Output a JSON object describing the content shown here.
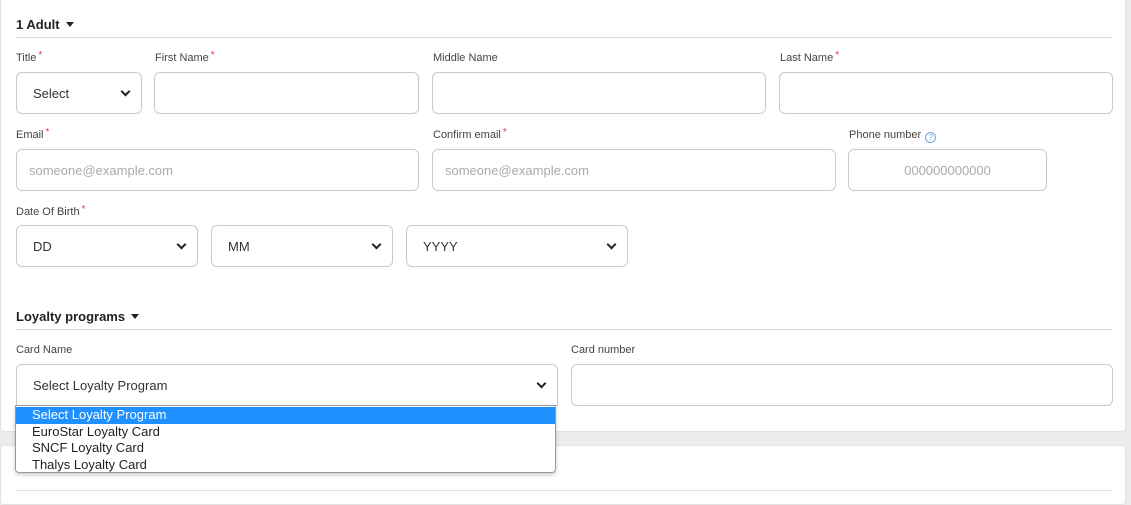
{
  "passenger": {
    "heading": "1 Adult",
    "title_label": "Title",
    "title_value": "Select",
    "first_name_label": "First Name",
    "middle_name_label": "Middle Name",
    "last_name_label": "Last Name",
    "email_label": "Email",
    "email_placeholder": "someone@example.com",
    "confirm_email_label": "Confirm email",
    "confirm_email_placeholder": "someone@example.com",
    "phone_label": "Phone number",
    "phone_help_icon": "question-circle-icon",
    "phone_placeholder": "000000000000",
    "dob_label": "Date Of Birth",
    "dob_day": "DD",
    "dob_month": "MM",
    "dob_year": "YYYY",
    "required_marker": "*"
  },
  "loyalty": {
    "heading": "Loyalty programs",
    "card_name_label": "Card Name",
    "card_name_value": "Select Loyalty Program",
    "card_number_label": "Card number",
    "options": [
      "Select Loyalty Program",
      "EuroStar Loyalty Card",
      "SNCF Loyalty Card",
      "Thalys Loyalty Card"
    ]
  },
  "colors": {
    "required": "#e53935",
    "selected_option": "#1e90ff",
    "help_icon": "#6aa8e6"
  }
}
